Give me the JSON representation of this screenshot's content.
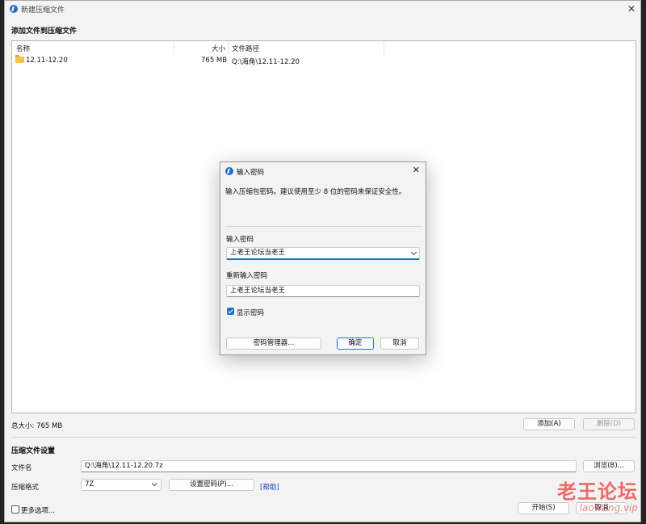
{
  "window": {
    "title": "新建压缩文件"
  },
  "files_section": {
    "title": "添加文件到压缩文件",
    "columns": {
      "name": "名称",
      "size": "大小",
      "path": "文件路径"
    },
    "rows": [
      {
        "name": "12.11-12.20",
        "size": "765 MB",
        "path": "Q:\\海角\\12.11-12.20"
      }
    ],
    "total_size": "总大小: 765 MB",
    "add_button": "添加(A)",
    "delete_button": "删除(D)"
  },
  "settings": {
    "title": "压缩文件设置",
    "filename_label": "文件名",
    "filename_value": "Q:\\海角\\12.11-12.20.7z",
    "browse_button": "浏览(B)...",
    "format_label": "压缩格式",
    "format_value": "7Z",
    "set_password_button": "设置密码(P)...",
    "help_link": "[帮助]",
    "more_options": "更多选项...",
    "start_button": "开始(S)",
    "cancel_button": "取消"
  },
  "password_dialog": {
    "title": "输入密码",
    "description": "输入压缩包密码。建议使用至少 8 位的密码来保证安全性。",
    "password_label": "输入密码",
    "password_value": "上老王论坛当老王",
    "reenter_label": "重新输入密码",
    "reenter_value": "上老王论坛当老王",
    "show_password_label": "显示密码",
    "show_password_checked": true,
    "manager_button": "密码管理器...",
    "ok_button": "确定",
    "cancel_button": "取消"
  },
  "watermark": {
    "main": "老王论坛",
    "sub": "laowang.vip"
  },
  "colors": {
    "accent": "#1f6fd0",
    "watermark": "#e83c3c"
  }
}
